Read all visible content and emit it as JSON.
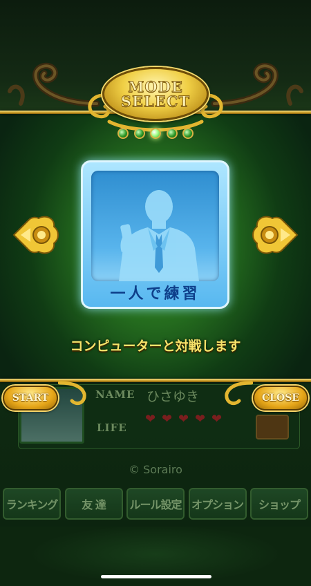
{
  "header": {
    "mode_line1": "MODE",
    "mode_line2": "SELECT",
    "page_indicators": 5,
    "active_indicator": 3
  },
  "mode_card": {
    "icon": "businessman-phone-icon",
    "label": "一人で練習"
  },
  "description": "コンピューターと対戦します",
  "buttons": {
    "start": "START",
    "close": "CLOSE",
    "prev_arrow": "left-arrow-icon",
    "next_arrow": "right-arrow-icon"
  },
  "profile": {
    "name_label": "NAME",
    "name_value": "ひさゆき",
    "life_label": "LIFE",
    "life_count": 5
  },
  "copyright": "© Sorairo",
  "nav": [
    "ランキング",
    "友 達",
    "ルール設定",
    "オプション",
    "ショップ"
  ],
  "colors": {
    "gold": "#e6b62a",
    "green_glow": "#3f9b2a",
    "card_blue": "#58b8f0",
    "label_blue": "#0e3f8a",
    "description_yellow": "#f7e36a"
  }
}
